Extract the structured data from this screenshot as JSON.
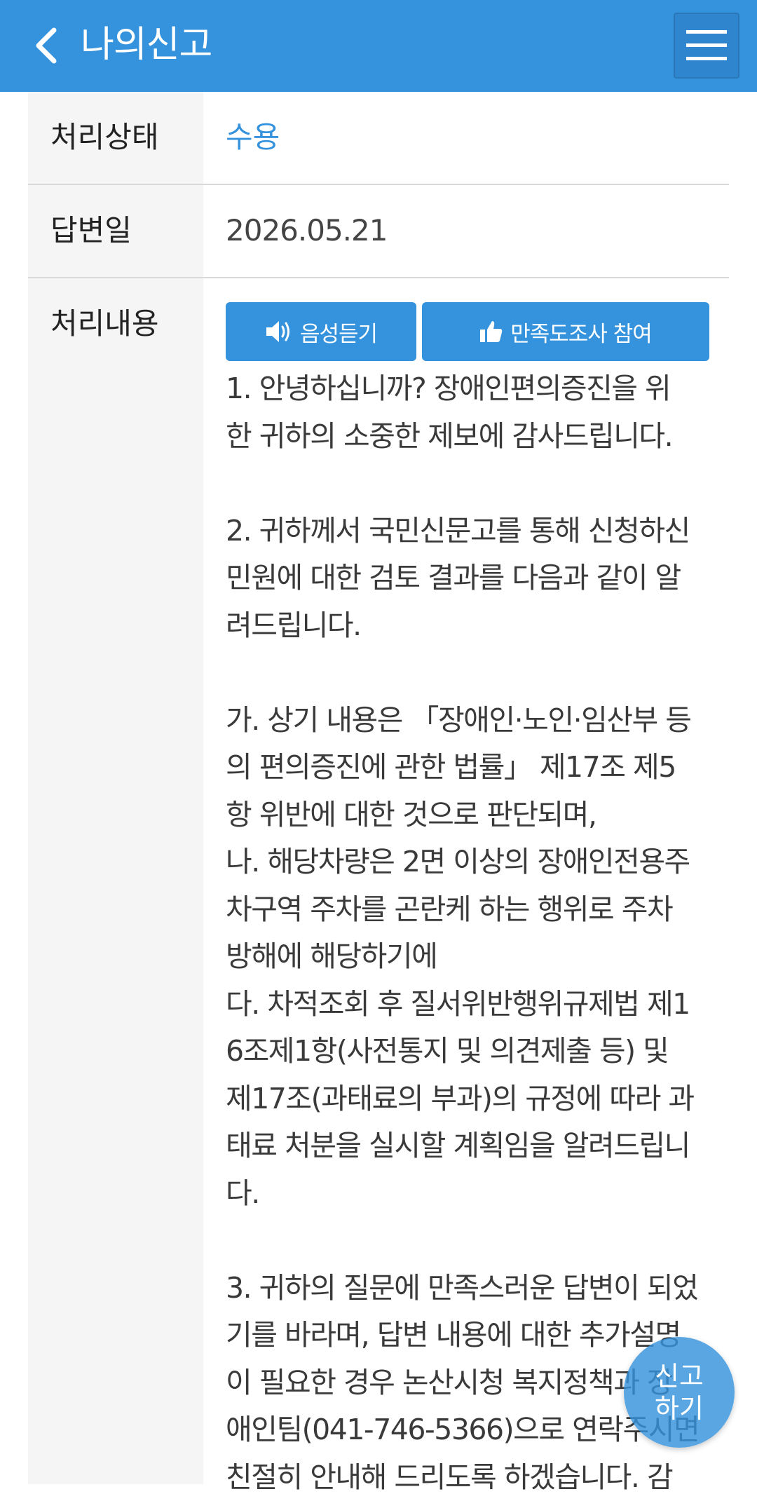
{
  "header": {
    "title": "나의신고",
    "back_icon": "chevron-left-icon",
    "menu_icon": "hamburger-menu-icon"
  },
  "details": {
    "status_label": "처리상태",
    "status_value": "수용",
    "answer_date_label": "답변일",
    "answer_date_value": "2026.05.21",
    "content_label": "처리내용"
  },
  "actions": {
    "listen_label": "음성듣기",
    "survey_label": "만족도조사 참여"
  },
  "content_lines": [
    "1. 안녕하십니까? 장애인편의증진을 위",
    "한 귀하의 소중한 제보에 감사드립니다.",
    "",
    "2. 귀하께서 국민신문고를 통해 신청하신",
    "민원에 대한 검토 결과를 다음과 같이 알",
    "려드립니다.",
    "",
    "가. 상기 내용은 「장애인·노인·임산부 등",
    "의 편의증진에 관한 법률」 제17조 제5",
    "항 위반에 대한 것으로 판단되며,",
    "나. 해당차량은 2면 이상의 장애인전용주",
    "차구역 주차를 곤란케 하는 행위로 주차",
    "방해에 해당하기에",
    "다. 차적조회 후 질서위반행위규제법 제1",
    "6조제1항(사전통지 및 의견제출 등) 및",
    "제17조(과태료의 부과)의 규정에 따라 과",
    "태료 처분을 실시할 계획임을 알려드립니",
    "다.",
    "",
    "3. 귀하의 질문에 만족스러운 답변이 되었",
    "기를 바라며, 답변 내용에 대한 추가설명",
    "이 필요한 경우 논산시청 복지정책과 장",
    "애인팀(041-746-5366)으로 연락주시면",
    "친절히 안내해 드리도록 하겠습니다. 감"
  ],
  "fab": {
    "line1": "신고",
    "line2": "하기"
  },
  "colors": {
    "primary": "#3592dc",
    "label_bg": "#f5f5f5",
    "divider": "#d9d9d9"
  }
}
